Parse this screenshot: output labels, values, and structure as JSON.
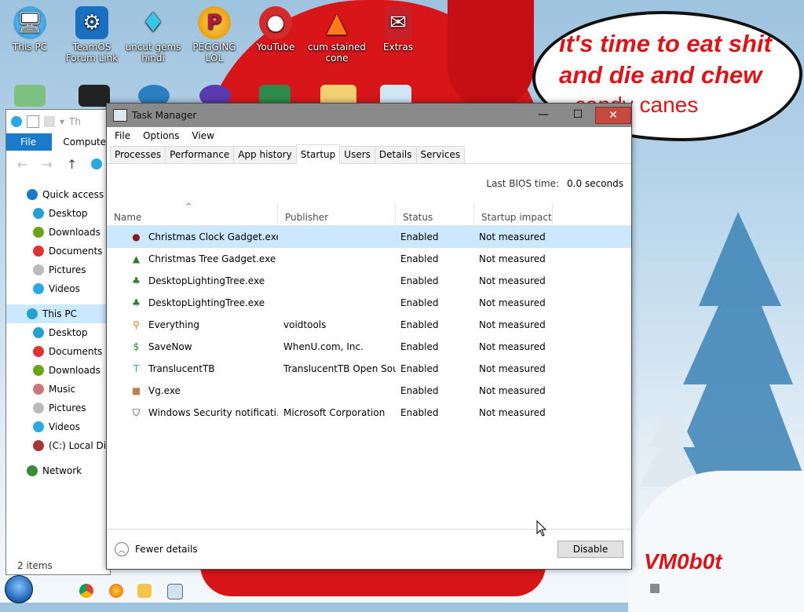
{
  "desktop": {
    "icons": [
      {
        "label": "This PC",
        "icon": "this-pc-icon"
      },
      {
        "label": "TeamOS Forum Link",
        "icon": "gear-icon"
      },
      {
        "label": "uncut gems hindi",
        "icon": "diamond-icon"
      },
      {
        "label": "PEGGING LOL",
        "icon": "p-logo-icon"
      },
      {
        "label": "YouTube",
        "icon": "angry-bird-icon"
      },
      {
        "label": "cum stained cone",
        "icon": "traffic-cone-icon"
      },
      {
        "label": "Extras",
        "icon": "card-icon"
      }
    ],
    "speech_line1": "it's time to eat shit",
    "speech_line2": "and die and chew",
    "speech_line3": "candy canes",
    "signature": "VM0b0t"
  },
  "explorer": {
    "title": "Th",
    "ribbon_file": "File",
    "ribbon_computer": "Computer",
    "nav_items": [
      {
        "label": "Quick access",
        "color": "#1979ca",
        "top": true
      },
      {
        "label": "Desktop",
        "color": "#25a0d0"
      },
      {
        "label": "Downloads",
        "color": "#6aa31a"
      },
      {
        "label": "Documents",
        "color": "#d33"
      },
      {
        "label": "Pictures",
        "color": "#bbb"
      },
      {
        "label": "Videos",
        "color": "#2aa9e0"
      },
      {
        "label": "This PC",
        "color": "#25a0d0",
        "top": true,
        "selected": true
      },
      {
        "label": "Desktop",
        "color": "#25a0d0"
      },
      {
        "label": "Documents",
        "color": "#d33"
      },
      {
        "label": "Downloads",
        "color": "#6aa31a"
      },
      {
        "label": "Music",
        "color": "#c77"
      },
      {
        "label": "Pictures",
        "color": "#bbb"
      },
      {
        "label": "Videos",
        "color": "#2aa9e0"
      },
      {
        "label": "(C:) Local Disk",
        "color": "#a33"
      },
      {
        "label": "Network",
        "color": "#3a8a3a",
        "top": true
      }
    ],
    "status": "2 items"
  },
  "task_manager": {
    "title": "Task Manager",
    "menu": [
      "File",
      "Options",
      "View"
    ],
    "tabs": [
      "Processes",
      "Performance",
      "App history",
      "Startup",
      "Users",
      "Details",
      "Services"
    ],
    "active_tab": "Startup",
    "bios_label": "Last BIOS time:",
    "bios_value": "0.0 seconds",
    "columns": {
      "name": "Name",
      "publisher": "Publisher",
      "status": "Status",
      "impact": "Startup impact"
    },
    "rows": [
      {
        "name": "Christmas Clock Gadget.exe",
        "publisher": "",
        "status": "Enabled",
        "impact": "Not measured",
        "icon": "ornament-icon",
        "color": "#8b1a1a",
        "glyph": "●",
        "selected": true
      },
      {
        "name": "Christmas Tree Gadget.exe",
        "publisher": "",
        "status": "Enabled",
        "impact": "Not measured",
        "icon": "christmas-tree-icon",
        "color": "#2f7a2f",
        "glyph": "▲"
      },
      {
        "name": "DesktopLightingTree.exe",
        "publisher": "",
        "status": "Enabled",
        "impact": "Not measured",
        "icon": "christmas-tree-icon",
        "color": "#2f7a2f",
        "glyph": "♣"
      },
      {
        "name": "DesktopLightingTree.exe",
        "publisher": "",
        "status": "Enabled",
        "impact": "Not measured",
        "icon": "christmas-tree-icon",
        "color": "#2f7a2f",
        "glyph": "♣"
      },
      {
        "name": "Everything",
        "publisher": "voidtools",
        "status": "Enabled",
        "impact": "Not measured",
        "icon": "magnifier-icon",
        "color": "#d97a00",
        "glyph": "⚲"
      },
      {
        "name": "SaveNow",
        "publisher": "WhenU.com, Inc.",
        "status": "Enabled",
        "impact": "Not measured",
        "icon": "dollar-icon",
        "color": "#1f8a3a",
        "glyph": "$"
      },
      {
        "name": "TranslucentTB",
        "publisher": "TranslucentTB Open Sou...",
        "status": "Enabled",
        "impact": "Not measured",
        "icon": "translucenttb-icon",
        "color": "#3aa39a",
        "glyph": "T"
      },
      {
        "name": "Vg.exe",
        "publisher": "",
        "status": "Enabled",
        "impact": "Not measured",
        "icon": "app-image-icon",
        "color": "#b8864a",
        "glyph": "■"
      },
      {
        "name": "Windows Security notificati...",
        "publisher": "Microsoft Corporation",
        "status": "Enabled",
        "impact": "Not measured",
        "icon": "shield-icon",
        "color": "#222",
        "glyph": "⛉"
      }
    ],
    "fewer_details": "Fewer details",
    "disable_button": "Disable"
  },
  "taskbar": {
    "items": [
      "chrome-icon",
      "firefox-icon",
      "file-explorer-icon",
      "task-manager-icon"
    ]
  }
}
